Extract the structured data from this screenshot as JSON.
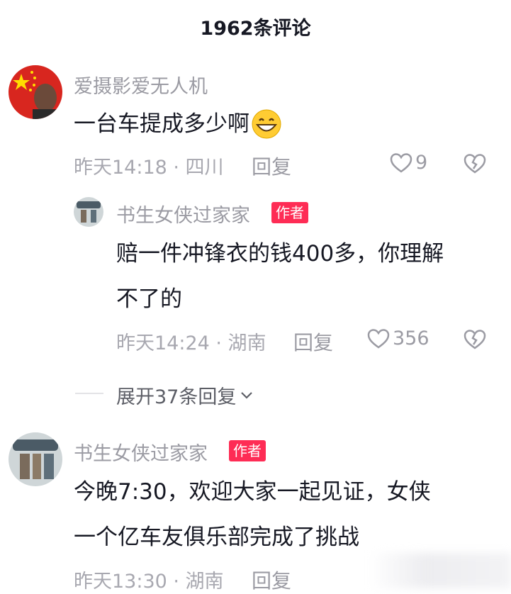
{
  "header": {
    "title": "1962条评论"
  },
  "comments": [
    {
      "username": "爱摄影爱无人机",
      "text": "一台车提成多少啊",
      "emoji": "grinning-face-icon",
      "time_location": "昨天14:18 · 四川",
      "reply_label": "回复",
      "likes": "9"
    },
    {
      "username": "书生女侠过家家",
      "badge": "作者",
      "text_line1": "赔一件冲锋衣的钱400多，你理解",
      "text_line2": "不了的",
      "time_location": "昨天14:24 · 湖南",
      "reply_label": "回复",
      "likes": "356"
    },
    {
      "username": "书生女侠过家家",
      "badge": "作者",
      "text_line1": "今晚7:30，欢迎大家一起见证，女侠",
      "text_line2": "一个亿车友俱乐部完成了挑战",
      "time_location": "昨天13:30 · 湖南",
      "reply_label": "回复"
    }
  ],
  "expand_replies": {
    "label": "展开37条回复"
  },
  "colors": {
    "badge": "#fe2c55",
    "meta": "#a8a8b0",
    "text": "#161823"
  }
}
